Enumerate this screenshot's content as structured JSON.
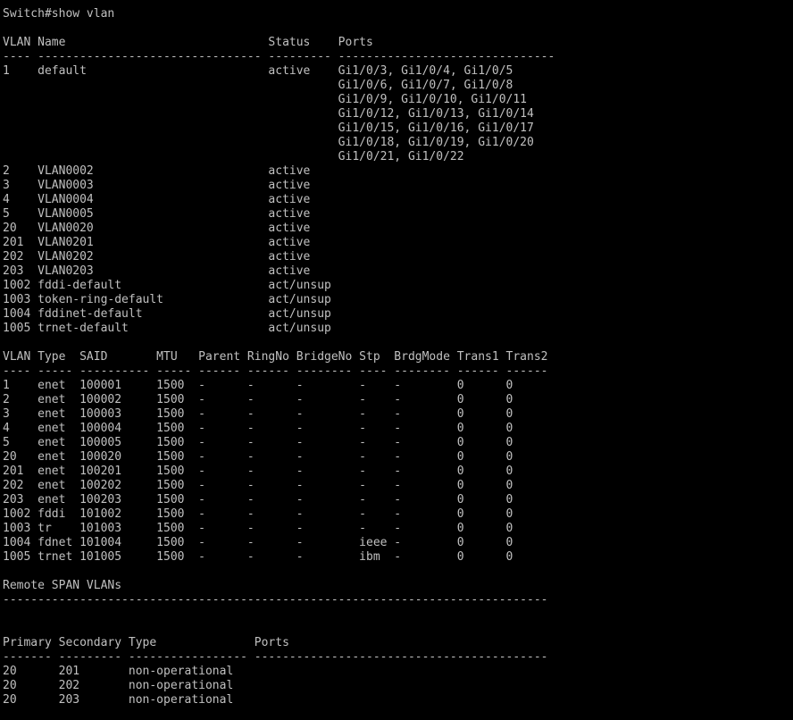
{
  "terminal": {
    "lines": [
      "Switch#show vlan",
      "",
      "VLAN Name                             Status    Ports",
      "---- -------------------------------- --------- -------------------------------",
      "1    default                          active    Gi1/0/3, Gi1/0/4, Gi1/0/5",
      "                                                Gi1/0/6, Gi1/0/7, Gi1/0/8",
      "                                                Gi1/0/9, Gi1/0/10, Gi1/0/11",
      "                                                Gi1/0/12, Gi1/0/13, Gi1/0/14",
      "                                                Gi1/0/15, Gi1/0/16, Gi1/0/17",
      "                                                Gi1/0/18, Gi1/0/19, Gi1/0/20",
      "                                                Gi1/0/21, Gi1/0/22",
      "2    VLAN0002                         active",
      "3    VLAN0003                         active",
      "4    VLAN0004                         active",
      "5    VLAN0005                         active",
      "20   VLAN0020                         active",
      "201  VLAN0201                         active",
      "202  VLAN0202                         active",
      "203  VLAN0203                         active",
      "1002 fddi-default                     act/unsup",
      "1003 token-ring-default               act/unsup",
      "1004 fddinet-default                  act/unsup",
      "1005 trnet-default                    act/unsup",
      "",
      "VLAN Type  SAID       MTU   Parent RingNo BridgeNo Stp  BrdgMode Trans1 Trans2",
      "---- ----- ---------- ----- ------ ------ -------- ---- -------- ------ ------",
      "1    enet  100001     1500  -      -      -        -    -        0      0",
      "2    enet  100002     1500  -      -      -        -    -        0      0",
      "3    enet  100003     1500  -      -      -        -    -        0      0",
      "4    enet  100004     1500  -      -      -        -    -        0      0",
      "5    enet  100005     1500  -      -      -        -    -        0      0",
      "20   enet  100020     1500  -      -      -        -    -        0      0",
      "201  enet  100201     1500  -      -      -        -    -        0      0",
      "202  enet  100202     1500  -      -      -        -    -        0      0",
      "203  enet  100203     1500  -      -      -        -    -        0      0",
      "1002 fddi  101002     1500  -      -      -        -    -        0      0",
      "1003 tr    101003     1500  -      -      -        -    -        0      0",
      "1004 fdnet 101004     1500  -      -      -        ieee -        0      0",
      "1005 trnet 101005     1500  -      -      -        ibm  -        0      0",
      "",
      "Remote SPAN VLANs",
      "------------------------------------------------------------------------------",
      "",
      "",
      "Primary Secondary Type              Ports",
      "------- --------- ----------------- ------------------------------------------",
      "20      201       non-operational",
      "20      202       non-operational",
      "20      203       non-operational"
    ]
  },
  "colors": {
    "background": "#000000",
    "text": "#c0c0c0"
  }
}
